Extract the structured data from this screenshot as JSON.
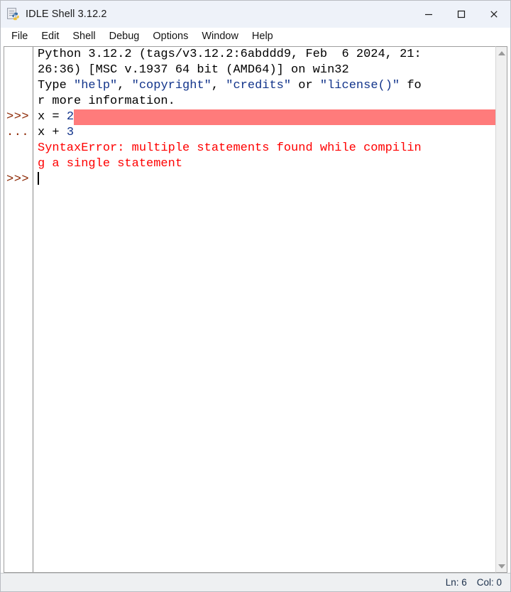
{
  "window": {
    "title": "IDLE Shell 3.12.2",
    "icon": "python-file-icon",
    "controls": {
      "minimize": "minimize-icon",
      "maximize": "maximize-icon",
      "close": "close-icon"
    }
  },
  "menu": {
    "items": [
      {
        "label": "File"
      },
      {
        "label": "Edit"
      },
      {
        "label": "Shell"
      },
      {
        "label": "Debug"
      },
      {
        "label": "Options"
      },
      {
        "label": "Window"
      },
      {
        "label": "Help"
      }
    ]
  },
  "shell": {
    "prompts": [
      "",
      "",
      "",
      "",
      ">>>",
      "...",
      "",
      "",
      ">>>"
    ],
    "lines": [
      {
        "segments": [
          {
            "text": "Python 3.12.2 (tags/v3.12.2:6abddd9, Feb  6 2024, 21:",
            "style": "plain"
          }
        ]
      },
      {
        "segments": [
          {
            "text": "26:36) [MSC v.1937 64 bit (AMD64)] on win32",
            "style": "plain"
          }
        ]
      },
      {
        "segments": [
          {
            "text": "Type ",
            "style": "plain"
          },
          {
            "text": "\"help\"",
            "style": "builtin"
          },
          {
            "text": ", ",
            "style": "plain"
          },
          {
            "text": "\"copyright\"",
            "style": "builtin"
          },
          {
            "text": ", ",
            "style": "plain"
          },
          {
            "text": "\"credits\"",
            "style": "builtin"
          },
          {
            "text": " or ",
            "style": "plain"
          },
          {
            "text": "\"license()\"",
            "style": "builtin"
          },
          {
            "text": " fo",
            "style": "plain"
          }
        ]
      },
      {
        "segments": [
          {
            "text": "r more information.",
            "style": "plain"
          }
        ]
      },
      {
        "selection": true,
        "segments": [
          {
            "text": "x = ",
            "style": "plain"
          },
          {
            "text": "2",
            "style": "number"
          }
        ]
      },
      {
        "segments": [
          {
            "text": "x + ",
            "style": "plain"
          },
          {
            "text": "3",
            "style": "number"
          }
        ]
      },
      {
        "segments": [
          {
            "text": "SyntaxError: multiple statements found while compilin",
            "style": "error"
          }
        ]
      },
      {
        "segments": [
          {
            "text": "g a single statement",
            "style": "error"
          }
        ]
      },
      {
        "caret": true,
        "segments": []
      }
    ],
    "selection_color": "#ff7b7b",
    "error_color": "#ff0000",
    "prompt_color": "#8b2500",
    "number_color": "#12348b"
  },
  "scrollbar": {
    "up_arrow": "scroll-up-arrow-icon",
    "down_arrow": "scroll-down-arrow-icon"
  },
  "status": {
    "line": "Ln: 6",
    "column": "Col: 0"
  }
}
